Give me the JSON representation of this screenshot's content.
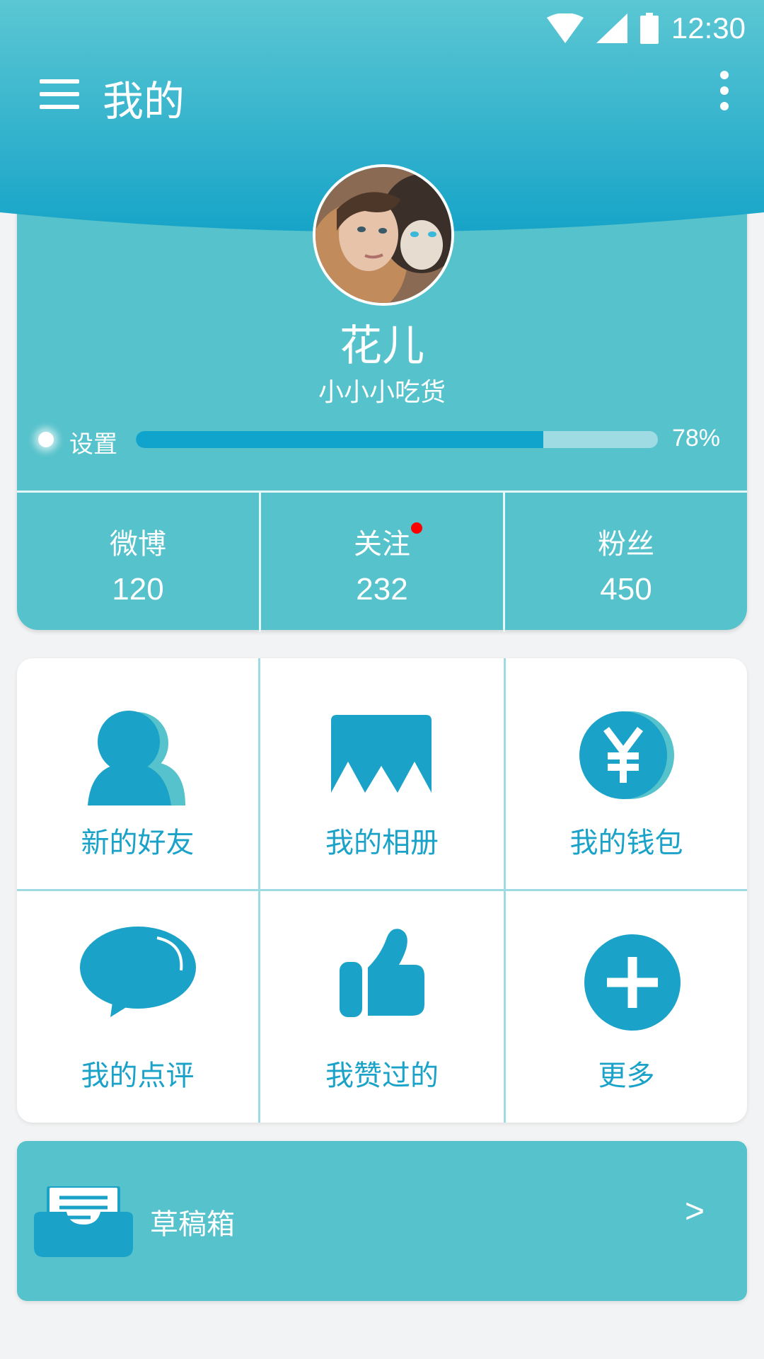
{
  "status_bar": {
    "time": "12:30"
  },
  "app_bar": {
    "title": "我的"
  },
  "profile": {
    "name": "花儿",
    "bio": "小小小吃货",
    "progress": {
      "label": "设置",
      "value": 0.78,
      "text": "78%"
    },
    "stats": [
      {
        "label": "微博",
        "value": "120"
      },
      {
        "label": "关注",
        "value": "232",
        "has_notification": true
      },
      {
        "label": "粉丝",
        "value": "450"
      }
    ]
  },
  "menu_grid": [
    {
      "label": "新的好友",
      "icon": "person-icon"
    },
    {
      "label": "我的相册",
      "icon": "photo-album-icon"
    },
    {
      "label": "我的钱包",
      "icon": "wallet-yen-icon"
    },
    {
      "label": "我的点评",
      "icon": "speech-bubble-icon"
    },
    {
      "label": "我赞过的",
      "icon": "thumbs-up-icon"
    },
    {
      "label": "更多",
      "icon": "plus-circle-icon"
    }
  ],
  "drafts": {
    "label": "草稿箱",
    "chevron": ">"
  },
  "colors": {
    "primary": "#1aa2c8",
    "card": "#56c2cb",
    "header_top": "#5bc7d3",
    "header_bottom": "#17a4c8",
    "notification": "#ff0000"
  }
}
